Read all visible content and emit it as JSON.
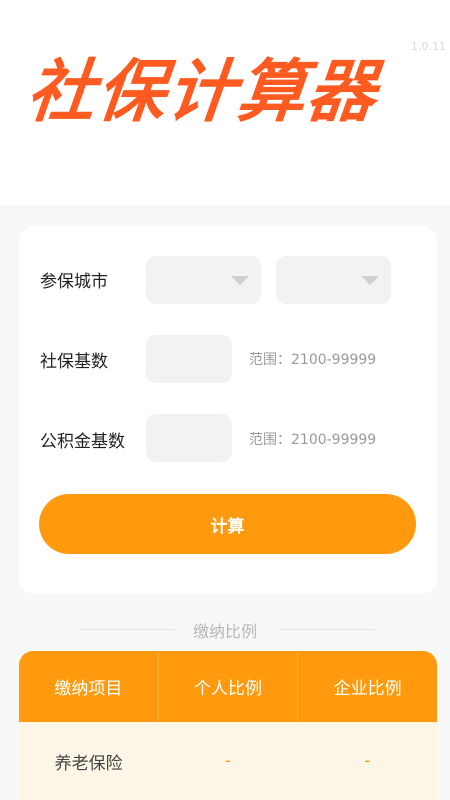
{
  "header": {
    "logo_text": "社保计算器",
    "version": "1.0.11"
  },
  "form": {
    "city_label": "参保城市",
    "city_select_1": "",
    "city_select_2": "",
    "social_base_label": "社保基数",
    "social_base_value": "",
    "social_base_hint": "范围：2100-99999",
    "fund_base_label": "公积金基数",
    "fund_base_value": "",
    "fund_base_hint": "范围：2100-99999",
    "calc_button": "计算"
  },
  "ratio_section": {
    "title": "缴纳比例",
    "columns": [
      "缴纳项目",
      "个人比例",
      "企业比例"
    ],
    "rows": [
      {
        "item": "养老保险",
        "personal": "-",
        "company": "-"
      }
    ]
  },
  "colors": {
    "accent": "#ff9a0f",
    "logo": "#ff5a1f"
  }
}
